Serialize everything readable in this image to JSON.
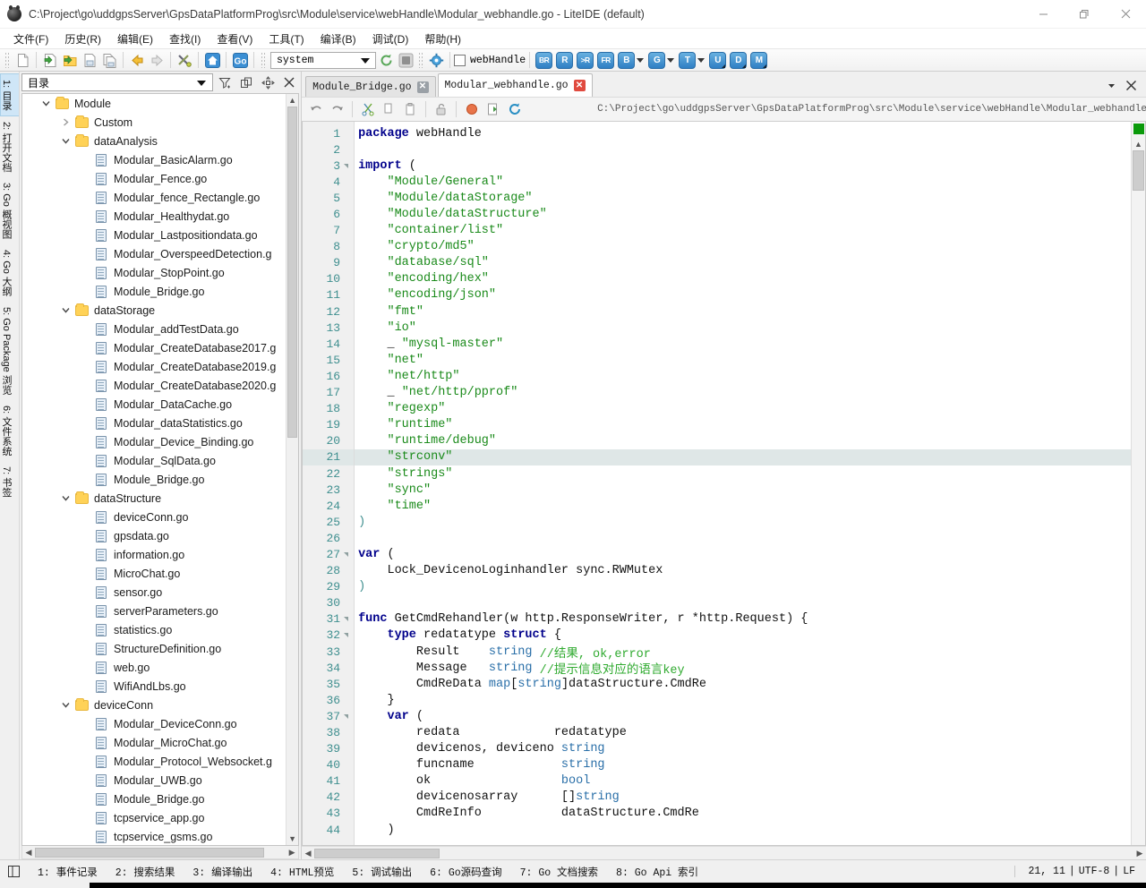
{
  "window": {
    "title": "C:\\Project\\go\\uddgpsServer\\GpsDataPlatformProg\\src\\Module\\service\\webHandle\\Modular_webhandle.go - LiteIDE (default)",
    "app_icon": "liteide-logo-icon",
    "minimize": "minimize-icon",
    "maximize": "restore-icon",
    "close": "close-icon"
  },
  "menubar": {
    "items": [
      {
        "label": "文件(F)",
        "name": "menu-file"
      },
      {
        "label": "历史(R)",
        "name": "menu-history"
      },
      {
        "label": "编辑(E)",
        "name": "menu-edit"
      },
      {
        "label": "查找(I)",
        "name": "menu-find"
      },
      {
        "label": "查看(V)",
        "name": "menu-view"
      },
      {
        "label": "工具(T)",
        "name": "menu-tools"
      },
      {
        "label": "编译(B)",
        "name": "menu-build"
      },
      {
        "label": "调试(D)",
        "name": "menu-debug"
      },
      {
        "label": "帮助(H)",
        "name": "menu-help"
      }
    ]
  },
  "toolbar": {
    "icons": [
      "new-file-icon",
      "open-file-icon",
      "open-folder-icon",
      "save-file-icon",
      "save-all-icon",
      "back-arrow-icon",
      "forward-arrow-icon",
      "tools-icon",
      "home-icon",
      "go-icon",
      "stop-icon",
      "gear-icon"
    ],
    "environment_value": "system",
    "build_checkbox_label": "webHandle",
    "build_checkbox_checked": false,
    "action_buttons": [
      {
        "label": "BR",
        "name": "build-run-button",
        "dropdown": false
      },
      {
        "label": "R",
        "name": "run-button",
        "dropdown": false
      },
      {
        "label": ">R",
        "name": "run-args-button",
        "dropdown": false
      },
      {
        "label": "FR",
        "name": "file-run-button",
        "dropdown": false
      },
      {
        "label": "B",
        "name": "build-button",
        "dropdown": true
      },
      {
        "label": "G",
        "name": "get-button",
        "dropdown": true
      },
      {
        "label": "T",
        "name": "test-button",
        "dropdown": true
      },
      {
        "label": "U",
        "name": "update-button",
        "dropdown": false
      },
      {
        "label": "D",
        "name": "doc-button",
        "dropdown": false
      },
      {
        "label": "M",
        "name": "make-button",
        "dropdown": false
      }
    ]
  },
  "sidebar": {
    "tabs": [
      {
        "label": "1: 目录",
        "name": "sidebar-tab-folders",
        "active": true
      },
      {
        "label": "2: 打开文档",
        "name": "sidebar-tab-open-documents",
        "active": false
      },
      {
        "label": "3: Go 概视图",
        "name": "sidebar-tab-go-overview",
        "active": false
      },
      {
        "label": "4: Go 大纲",
        "name": "sidebar-tab-go-outline",
        "active": false
      },
      {
        "label": "5: Go Package 浏览",
        "name": "sidebar-tab-go-package-browser",
        "active": false
      },
      {
        "label": "6: 文件系统",
        "name": "sidebar-tab-filesystem",
        "active": false
      },
      {
        "label": "7: 书签",
        "name": "sidebar-tab-bookmarks",
        "active": false
      }
    ]
  },
  "filepanel": {
    "combo_value": "目录",
    "header_icons": [
      "filter-icon",
      "collapse-all-icon",
      "sync-location-icon",
      "close-icon"
    ],
    "tree": [
      {
        "depth": 0,
        "type": "folder",
        "label": "Module",
        "expanded": true
      },
      {
        "depth": 1,
        "type": "folder",
        "label": "Custom",
        "expanded": false
      },
      {
        "depth": 1,
        "type": "folder",
        "label": "dataAnalysis",
        "expanded": true
      },
      {
        "depth": 2,
        "type": "file",
        "label": "Modular_BasicAlarm.go"
      },
      {
        "depth": 2,
        "type": "file",
        "label": "Modular_Fence.go"
      },
      {
        "depth": 2,
        "type": "file",
        "label": "Modular_fence_Rectangle.go"
      },
      {
        "depth": 2,
        "type": "file",
        "label": "Modular_Healthydat.go"
      },
      {
        "depth": 2,
        "type": "file",
        "label": "Modular_Lastpositiondata.go"
      },
      {
        "depth": 2,
        "type": "file",
        "label": "Modular_OverspeedDetection.g"
      },
      {
        "depth": 2,
        "type": "file",
        "label": "Modular_StopPoint.go"
      },
      {
        "depth": 2,
        "type": "file",
        "label": "Module_Bridge.go"
      },
      {
        "depth": 1,
        "type": "folder",
        "label": "dataStorage",
        "expanded": true
      },
      {
        "depth": 2,
        "type": "file",
        "label": "Modular_addTestData.go"
      },
      {
        "depth": 2,
        "type": "file",
        "label": "Modular_CreateDatabase2017.g"
      },
      {
        "depth": 2,
        "type": "file",
        "label": "Modular_CreateDatabase2019.g"
      },
      {
        "depth": 2,
        "type": "file",
        "label": "Modular_CreateDatabase2020.g"
      },
      {
        "depth": 2,
        "type": "file",
        "label": "Modular_DataCache.go"
      },
      {
        "depth": 2,
        "type": "file",
        "label": "Modular_dataStatistics.go"
      },
      {
        "depth": 2,
        "type": "file",
        "label": "Modular_Device_Binding.go"
      },
      {
        "depth": 2,
        "type": "file",
        "label": "Modular_SqlData.go"
      },
      {
        "depth": 2,
        "type": "file",
        "label": "Module_Bridge.go"
      },
      {
        "depth": 1,
        "type": "folder",
        "label": "dataStructure",
        "expanded": true
      },
      {
        "depth": 2,
        "type": "file",
        "label": "deviceConn.go"
      },
      {
        "depth": 2,
        "type": "file",
        "label": "gpsdata.go"
      },
      {
        "depth": 2,
        "type": "file",
        "label": "information.go"
      },
      {
        "depth": 2,
        "type": "file",
        "label": "MicroChat.go"
      },
      {
        "depth": 2,
        "type": "file",
        "label": "sensor.go"
      },
      {
        "depth": 2,
        "type": "file",
        "label": "serverParameters.go"
      },
      {
        "depth": 2,
        "type": "file",
        "label": "statistics.go"
      },
      {
        "depth": 2,
        "type": "file",
        "label": "StructureDefinition.go"
      },
      {
        "depth": 2,
        "type": "file",
        "label": "web.go"
      },
      {
        "depth": 2,
        "type": "file",
        "label": "WifiAndLbs.go"
      },
      {
        "depth": 1,
        "type": "folder",
        "label": "deviceConn",
        "expanded": true
      },
      {
        "depth": 2,
        "type": "file",
        "label": "Modular_DeviceConn.go"
      },
      {
        "depth": 2,
        "type": "file",
        "label": "Modular_MicroChat.go"
      },
      {
        "depth": 2,
        "type": "file",
        "label": "Modular_Protocol_Websocket.g"
      },
      {
        "depth": 2,
        "type": "file",
        "label": "Modular_UWB.go"
      },
      {
        "depth": 2,
        "type": "file",
        "label": "Module_Bridge.go"
      },
      {
        "depth": 2,
        "type": "file",
        "label": "tcpservice_app.go"
      },
      {
        "depth": 2,
        "type": "file",
        "label": "tcpservice_gsms.go"
      }
    ]
  },
  "editor": {
    "tabs": [
      {
        "label": "Module_Bridge.go",
        "name": "editor-tab-module-bridge",
        "active": false,
        "close_red": false
      },
      {
        "label": "Modular_webhandle.go",
        "name": "editor-tab-modular-webhandle",
        "active": true,
        "close_red": true
      }
    ],
    "tab_menu_icon": "chevron-down-icon",
    "tab_close_icon": "close-icon",
    "toolbar_icons": [
      "undo-icon",
      "redo-icon",
      "cut-icon",
      "copy-icon",
      "paste-icon",
      "unlock-icon",
      "breakpoint-icon",
      "export-icon",
      "reload-icon"
    ],
    "path": "C:\\Project\\go\\uddgpsServer\\GpsDataPlatformProg\\src\\Module\\service\\webHandle\\Modular_webhandle.go",
    "current_line": 21,
    "lines": [
      {
        "n": 1,
        "fold": false,
        "tokens": [
          {
            "t": "package ",
            "c": "kw"
          },
          {
            "t": "webHandle",
            "c": ""
          }
        ]
      },
      {
        "n": 2,
        "fold": false,
        "tokens": []
      },
      {
        "n": 3,
        "fold": true,
        "tokens": [
          {
            "t": "import ",
            "c": "kw"
          },
          {
            "t": "(",
            "c": ""
          }
        ]
      },
      {
        "n": 4,
        "fold": false,
        "tokens": [
          {
            "t": "    ",
            "c": ""
          },
          {
            "t": "\"Module/General\"",
            "c": "str"
          }
        ]
      },
      {
        "n": 5,
        "fold": false,
        "tokens": [
          {
            "t": "    ",
            "c": ""
          },
          {
            "t": "\"Module/dataStorage\"",
            "c": "str"
          }
        ]
      },
      {
        "n": 6,
        "fold": false,
        "tokens": [
          {
            "t": "    ",
            "c": ""
          },
          {
            "t": "\"Module/dataStructure\"",
            "c": "str"
          }
        ]
      },
      {
        "n": 7,
        "fold": false,
        "tokens": [
          {
            "t": "    ",
            "c": ""
          },
          {
            "t": "\"container/list\"",
            "c": "str"
          }
        ]
      },
      {
        "n": 8,
        "fold": false,
        "tokens": [
          {
            "t": "    ",
            "c": ""
          },
          {
            "t": "\"crypto/md5\"",
            "c": "str"
          }
        ]
      },
      {
        "n": 9,
        "fold": false,
        "tokens": [
          {
            "t": "    ",
            "c": ""
          },
          {
            "t": "\"database/sql\"",
            "c": "str"
          }
        ]
      },
      {
        "n": 10,
        "fold": false,
        "tokens": [
          {
            "t": "    ",
            "c": ""
          },
          {
            "t": "\"encoding/hex\"",
            "c": "str"
          }
        ]
      },
      {
        "n": 11,
        "fold": false,
        "tokens": [
          {
            "t": "    ",
            "c": ""
          },
          {
            "t": "\"encoding/json\"",
            "c": "str"
          }
        ]
      },
      {
        "n": 12,
        "fold": false,
        "tokens": [
          {
            "t": "    ",
            "c": ""
          },
          {
            "t": "\"fmt\"",
            "c": "str"
          }
        ]
      },
      {
        "n": 13,
        "fold": false,
        "tokens": [
          {
            "t": "    ",
            "c": ""
          },
          {
            "t": "\"io\"",
            "c": "str"
          }
        ]
      },
      {
        "n": 14,
        "fold": false,
        "tokens": [
          {
            "t": "    _ ",
            "c": ""
          },
          {
            "t": "\"mysql-master\"",
            "c": "str"
          }
        ]
      },
      {
        "n": 15,
        "fold": false,
        "tokens": [
          {
            "t": "    ",
            "c": ""
          },
          {
            "t": "\"net\"",
            "c": "str"
          }
        ]
      },
      {
        "n": 16,
        "fold": false,
        "tokens": [
          {
            "t": "    ",
            "c": ""
          },
          {
            "t": "\"net/http\"",
            "c": "str"
          }
        ]
      },
      {
        "n": 17,
        "fold": false,
        "tokens": [
          {
            "t": "    _ ",
            "c": ""
          },
          {
            "t": "\"net/http/pprof\"",
            "c": "str"
          }
        ]
      },
      {
        "n": 18,
        "fold": false,
        "tokens": [
          {
            "t": "    ",
            "c": ""
          },
          {
            "t": "\"regexp\"",
            "c": "str"
          }
        ]
      },
      {
        "n": 19,
        "fold": false,
        "tokens": [
          {
            "t": "    ",
            "c": ""
          },
          {
            "t": "\"runtime\"",
            "c": "str"
          }
        ]
      },
      {
        "n": 20,
        "fold": false,
        "tokens": [
          {
            "t": "    ",
            "c": ""
          },
          {
            "t": "\"runtime/debug\"",
            "c": "str"
          }
        ]
      },
      {
        "n": 21,
        "fold": false,
        "tokens": [
          {
            "t": "    ",
            "c": ""
          },
          {
            "t": "\"strconv\"",
            "c": "str"
          }
        ]
      },
      {
        "n": 22,
        "fold": false,
        "tokens": [
          {
            "t": "    ",
            "c": ""
          },
          {
            "t": "\"strings\"",
            "c": "str"
          }
        ]
      },
      {
        "n": 23,
        "fold": false,
        "tokens": [
          {
            "t": "    ",
            "c": ""
          },
          {
            "t": "\"sync\"",
            "c": "str"
          }
        ]
      },
      {
        "n": 24,
        "fold": false,
        "tokens": [
          {
            "t": "    ",
            "c": ""
          },
          {
            "t": "\"time\"",
            "c": "str"
          }
        ]
      },
      {
        "n": 25,
        "fold": false,
        "tokens": [
          {
            "t": ")",
            "c": "pun"
          }
        ]
      },
      {
        "n": 26,
        "fold": false,
        "tokens": []
      },
      {
        "n": 27,
        "fold": true,
        "tokens": [
          {
            "t": "var ",
            "c": "kw"
          },
          {
            "t": "(",
            "c": ""
          }
        ]
      },
      {
        "n": 28,
        "fold": false,
        "tokens": [
          {
            "t": "    Lock_DevicenoLoginhandler sync.RWMutex",
            "c": ""
          }
        ]
      },
      {
        "n": 29,
        "fold": false,
        "tokens": [
          {
            "t": ")",
            "c": "pun"
          }
        ]
      },
      {
        "n": 30,
        "fold": false,
        "tokens": []
      },
      {
        "n": 31,
        "fold": true,
        "tokens": [
          {
            "t": "func ",
            "c": "kw"
          },
          {
            "t": "GetCmdRehandler(w http.ResponseWriter, r *http.Request) {",
            "c": ""
          }
        ]
      },
      {
        "n": 32,
        "fold": true,
        "tokens": [
          {
            "t": "    ",
            "c": ""
          },
          {
            "t": "type ",
            "c": "kw"
          },
          {
            "t": "redatatype ",
            "c": ""
          },
          {
            "t": "struct ",
            "c": "kw"
          },
          {
            "t": "{",
            "c": ""
          }
        ]
      },
      {
        "n": 33,
        "fold": false,
        "tokens": [
          {
            "t": "        Result    ",
            "c": ""
          },
          {
            "t": "string",
            "c": "typ"
          },
          {
            "t": " ",
            "c": ""
          },
          {
            "t": "//结果, ok,error",
            "c": "cmt"
          }
        ]
      },
      {
        "n": 34,
        "fold": false,
        "tokens": [
          {
            "t": "        Message   ",
            "c": ""
          },
          {
            "t": "string",
            "c": "typ"
          },
          {
            "t": " ",
            "c": ""
          },
          {
            "t": "//提示信息对应的语言key",
            "c": "cmt"
          }
        ]
      },
      {
        "n": 35,
        "fold": false,
        "tokens": [
          {
            "t": "        CmdReData ",
            "c": ""
          },
          {
            "t": "map",
            "c": "typ"
          },
          {
            "t": "[",
            "c": ""
          },
          {
            "t": "string",
            "c": "typ"
          },
          {
            "t": "]dataStructure.CmdRe",
            "c": ""
          }
        ]
      },
      {
        "n": 36,
        "fold": false,
        "tokens": [
          {
            "t": "    }",
            "c": ""
          }
        ]
      },
      {
        "n": 37,
        "fold": true,
        "tokens": [
          {
            "t": "    ",
            "c": ""
          },
          {
            "t": "var ",
            "c": "kw"
          },
          {
            "t": "(",
            "c": ""
          }
        ]
      },
      {
        "n": 38,
        "fold": false,
        "tokens": [
          {
            "t": "        redata             redatatype",
            "c": ""
          }
        ]
      },
      {
        "n": 39,
        "fold": false,
        "tokens": [
          {
            "t": "        devicenos, deviceno ",
            "c": ""
          },
          {
            "t": "string",
            "c": "typ"
          }
        ]
      },
      {
        "n": 40,
        "fold": false,
        "tokens": [
          {
            "t": "        funcname            ",
            "c": ""
          },
          {
            "t": "string",
            "c": "typ"
          }
        ]
      },
      {
        "n": 41,
        "fold": false,
        "tokens": [
          {
            "t": "        ok                  ",
            "c": ""
          },
          {
            "t": "bool",
            "c": "typ"
          }
        ]
      },
      {
        "n": 42,
        "fold": false,
        "tokens": [
          {
            "t": "        devicenosarray      []",
            "c": ""
          },
          {
            "t": "string",
            "c": "typ"
          }
        ]
      },
      {
        "n": 43,
        "fold": false,
        "tokens": [
          {
            "t": "        CmdReInfo           dataStructure.CmdRe",
            "c": ""
          }
        ]
      },
      {
        "n": 44,
        "fold": false,
        "tokens": [
          {
            "t": "    )",
            "c": ""
          }
        ]
      }
    ]
  },
  "statusbar": {
    "toggle_icon": "panel-toggle-icon",
    "items": [
      {
        "label": "1: 事件记录",
        "name": "status-tab-events"
      },
      {
        "label": "2: 搜索结果",
        "name": "status-tab-search-results"
      },
      {
        "label": "3: 编译输出",
        "name": "status-tab-build-output"
      },
      {
        "label": "4: HTML预览",
        "name": "status-tab-html-preview"
      },
      {
        "label": "5: 调试输出",
        "name": "status-tab-debug-output"
      },
      {
        "label": "6: Go源码查询",
        "name": "status-tab-go-source-query"
      },
      {
        "label": "7: Go 文档搜索",
        "name": "status-tab-go-doc-search"
      },
      {
        "label": "8: Go Api 索引",
        "name": "status-tab-go-api-index"
      }
    ],
    "cursor": "21, 11",
    "encoding": "UTF-8",
    "line_ending": "LF",
    "separator": "|"
  }
}
